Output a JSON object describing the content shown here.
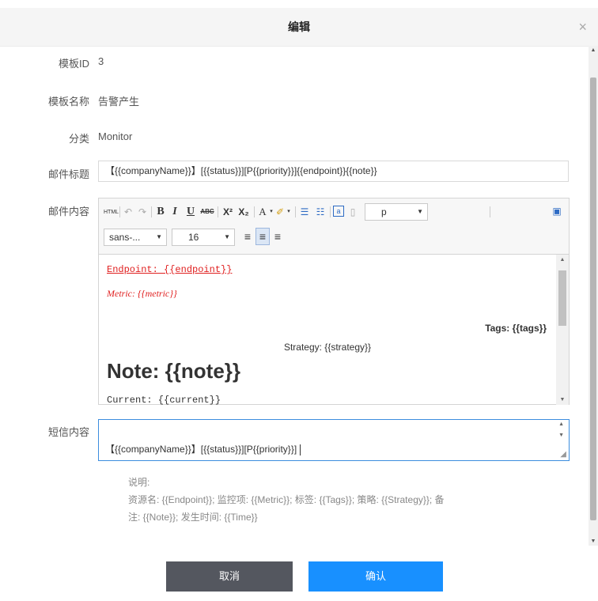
{
  "dialog": {
    "title": "编辑",
    "close_glyph": "×"
  },
  "fields": {
    "id_label": "模板ID",
    "id_value": "3",
    "name_label": "模板名称",
    "name_value": "告警产生",
    "category_label": "分类",
    "category_value": "Monitor",
    "subject_label": "邮件标题",
    "subject_value": "【{{companyName}}】[{{status}}][P{{priority}}]{{endpoint}}{{note}}",
    "mail_label": "邮件内容",
    "sms_label": "短信内容",
    "sms_value": "【{{companyName}}】[{{status}}][P{{priority}}]"
  },
  "toolbar": {
    "html": "HTML",
    "undo": "↶",
    "redo": "↷",
    "bold": "B",
    "italic": "I",
    "underline": "U",
    "strike": "ABC",
    "superscript": "X²",
    "subscript": "X₂",
    "font_color": "A",
    "highlight": "✐",
    "ordered_list": "☰",
    "unordered_list": "☷",
    "code": "a",
    "blank": "▯",
    "paragraph_format": "p",
    "font_family": "sans-...",
    "font_size": "16",
    "align_left": "≡",
    "align_center": "≡",
    "align_right": "≡",
    "fullscreen": "▣"
  },
  "editor_content": {
    "endpoint": "Endpoint: {{endpoint}}",
    "metric": "Metric: {{metric}}",
    "tags": "Tags: {{tags}}",
    "strategy": "Strategy: {{strategy}}",
    "note": "Note: {{note}}",
    "current": "Current: {{current}}"
  },
  "help": {
    "title": "说明:",
    "line1": "资源名: {{Endpoint}}; 监控项: {{Metric}}; 标签: {{Tags}}; 策略: {{Strategy}}; 备",
    "line2": "注: {{Note}}; 发生时间: {{Time}}"
  },
  "buttons": {
    "cancel": "取消",
    "confirm": "确认"
  },
  "colors": {
    "primary": "#1890ff",
    "cancel": "#54575f",
    "accent_red": "#e02020",
    "focus_border": "#3c8dde"
  }
}
